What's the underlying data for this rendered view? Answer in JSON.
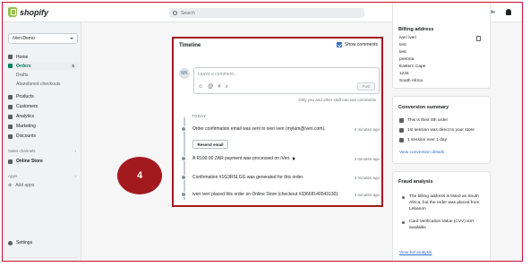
{
  "topbar": {
    "brand": "shopify",
    "search_placeholder": "Search",
    "setup_guide": "Setup guide"
  },
  "sidebar": {
    "store_name": "iVeri-Demo",
    "items": [
      {
        "label": "Home",
        "icon": "home-icon"
      },
      {
        "label": "Orders",
        "icon": "orders-icon",
        "badge": "5",
        "active": true
      },
      {
        "label": "Drafts",
        "sub": true
      },
      {
        "label": "Abandoned checkouts",
        "sub": true
      },
      {
        "label": "Products",
        "icon": "tag-icon"
      },
      {
        "label": "Customers",
        "icon": "person-icon"
      },
      {
        "label": "Analytics",
        "icon": "bar-chart-icon"
      },
      {
        "label": "Marketing",
        "icon": "target-icon"
      },
      {
        "label": "Discounts",
        "icon": "discount-icon"
      }
    ],
    "sales_channels_label": "Sales channels",
    "online_store": "Online Store",
    "apps_label": "Apps",
    "add_apps": "Add apps",
    "settings": "Settings"
  },
  "timeline": {
    "title": "Timeline",
    "show_comments_label": "Show comments",
    "avatar_initials": "MK",
    "comment_placeholder": "Leave a comment...",
    "tools": [
      "☺",
      "@",
      "#",
      "⌕"
    ],
    "post_label": "Post",
    "staff_note": "Only you and other staff can see comments",
    "day_label": "TODAY",
    "events": [
      {
        "text": "Order confirmation email was sent to iveri iveri (mylam@iveri.com).",
        "time": "4 minutes ago"
      },
      {
        "text": "A R100.00 ZAR payment was processed on iVeri.",
        "time": "4 minutes ago",
        "expandable": true
      },
      {
        "text": "Confirmation #1G3RSLGG was generated for this order.",
        "time": "4 minutes ago"
      },
      {
        "text": "iveri iveri placed this order on Online Store (checkout #33668140543130).",
        "time": "4 minutes ago"
      }
    ],
    "resend_label": "Resend email"
  },
  "step_marker": "4",
  "billing": {
    "title": "Billing address",
    "lines": [
      "iveri iveri",
      "test",
      "test",
      "pretoria",
      "Eastern Cape",
      "1234",
      "South Africa"
    ]
  },
  "conversion": {
    "title": "Conversion summary",
    "rows": [
      "This is their 0th order",
      "1st session was direct to your store",
      "1 session over 1 day"
    ],
    "link": "View conversion details"
  },
  "fraud": {
    "title": "Fraud analysis",
    "rows": [
      "The billing address is listed as South Africa, but the order was placed from Lebanon",
      "Card Verification Value (CVV) isn't available"
    ],
    "link": "View full analysis"
  },
  "colors": {
    "accent_green": "#008060",
    "highlight_red": "#a11820",
    "link_blue": "#2c6ecb"
  }
}
